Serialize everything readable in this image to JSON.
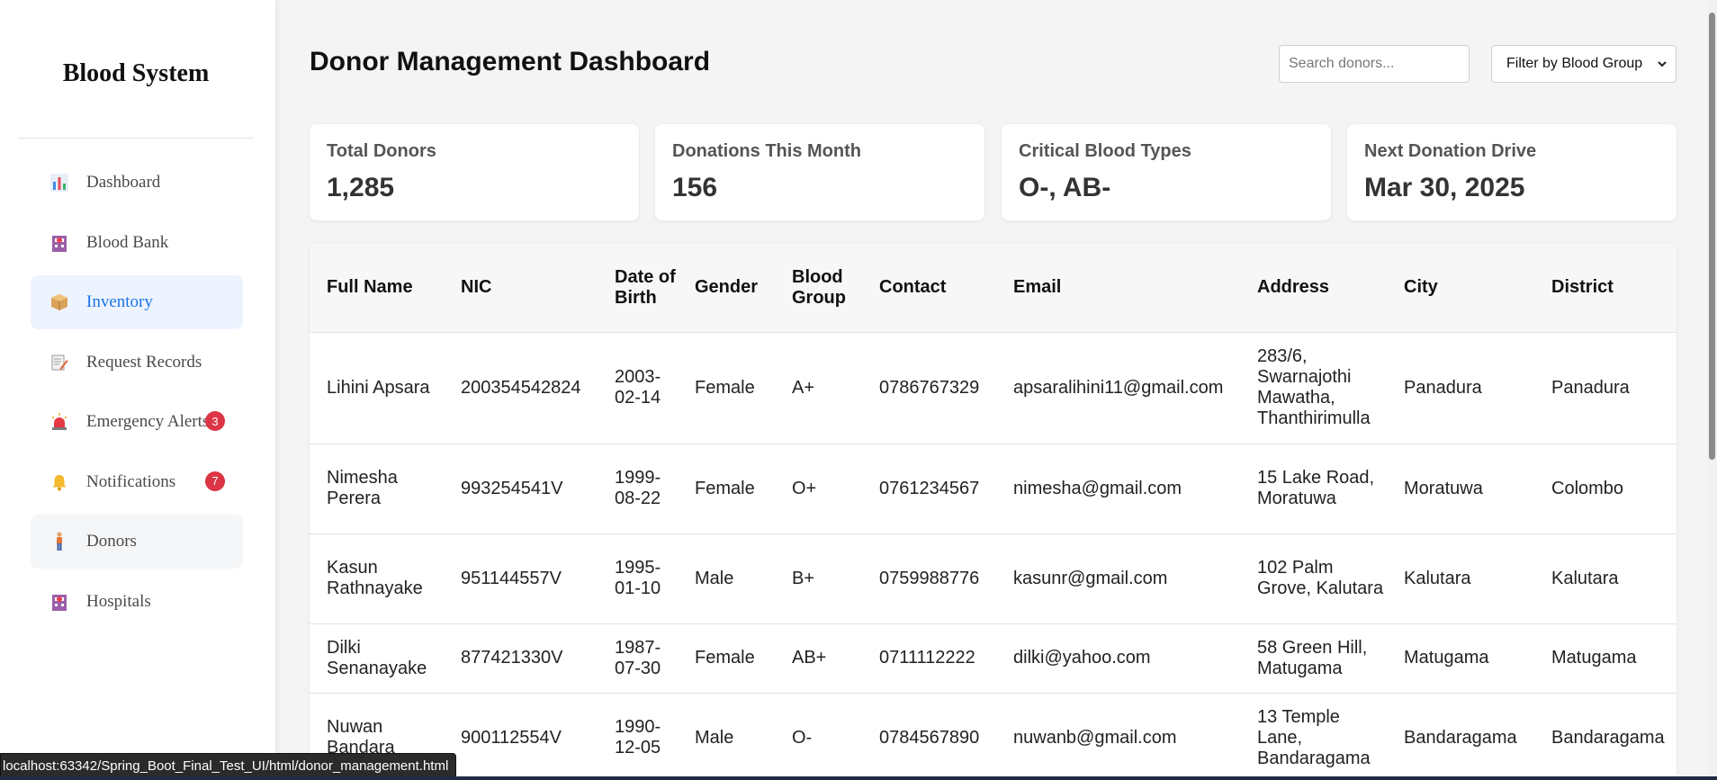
{
  "sidebar": {
    "brand": "Blood System",
    "items": [
      {
        "label": "Dashboard",
        "icon": "bar-chart-icon"
      },
      {
        "label": "Blood Bank",
        "icon": "hospital-icon"
      },
      {
        "label": "Inventory",
        "icon": "package-icon",
        "active": true
      },
      {
        "label": "Request Records",
        "icon": "memo-icon"
      },
      {
        "label": "Emergency Alerts",
        "icon": "siren-icon",
        "badge": "3"
      },
      {
        "label": "Notifications",
        "icon": "bell-icon",
        "badge": "7"
      },
      {
        "label": "Donors",
        "icon": "person-icon"
      },
      {
        "label": "Hospitals",
        "icon": "hospital-icon"
      }
    ]
  },
  "header": {
    "title": "Donor Management Dashboard",
    "search_placeholder": "Search donors...",
    "filter_label": "Filter by Blood Group"
  },
  "stats": [
    {
      "label": "Total Donors",
      "value": "1,285"
    },
    {
      "label": "Donations This Month",
      "value": "156"
    },
    {
      "label": "Critical Blood Types",
      "value": "O-, AB-"
    },
    {
      "label": "Next Donation Drive",
      "value": "Mar 30, 2025"
    }
  ],
  "table": {
    "columns": [
      "Full Name",
      "NIC",
      "Date of Birth",
      "Gender",
      "Blood Group",
      "Contact",
      "Email",
      "Address",
      "City",
      "District"
    ],
    "rows": [
      [
        "Lihini Apsara",
        "200354542824",
        "2003-02-14",
        "Female",
        "A+",
        "0786767329",
        "apsaralihini11@gmail.com",
        "283/6, Swarnajothi Mawatha, Thanthirimulla",
        "Panadura",
        "Panadura"
      ],
      [
        "Nimesha Perera",
        "993254541V",
        "1999-08-22",
        "Female",
        "O+",
        "0761234567",
        "nimesha@gmail.com",
        "15 Lake Road, Moratuwa",
        "Moratuwa",
        "Colombo"
      ],
      [
        "Kasun Rathnayake",
        "951144557V",
        "1995-01-10",
        "Male",
        "B+",
        "0759988776",
        "kasunr@gmail.com",
        "102 Palm Grove, Kalutara",
        "Kalutara",
        "Kalutara"
      ],
      [
        "Dilki Senanayake",
        "877421330V",
        "1987-07-30",
        "Female",
        "AB+",
        "0711112222",
        "dilki@yahoo.com",
        "58 Green Hill, Matugama",
        "Matugama",
        "Matugama"
      ],
      [
        "Nuwan Bandara",
        "900112554V",
        "1990-12-05",
        "Male",
        "O-",
        "0784567890",
        "nuwanb@gmail.com",
        "13 Temple Lane, Bandaragama",
        "Bandaragama",
        "Bandaragama"
      ]
    ]
  },
  "status_bar": {
    "url": "localhost:63342/Spring_Boot_Final_Test_UI/html/donor_management.html"
  },
  "colors": {
    "accent": "#1a73e8",
    "active_bg": "#eef4ff",
    "badge": "#dc3545"
  }
}
